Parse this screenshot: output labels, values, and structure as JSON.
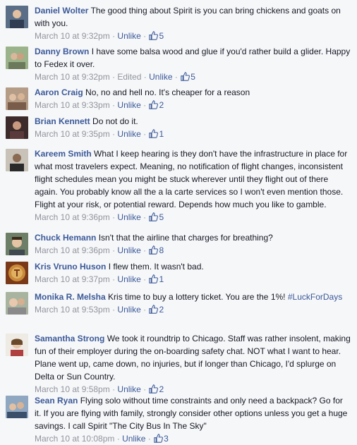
{
  "comments": [
    {
      "name": "Daniel Wolter",
      "text": "The good thing about Spirit is you can bring chickens and goats on with you.",
      "time": "March 10 at 9:32pm",
      "edited": "",
      "unlike": "Unlike",
      "likes": "5",
      "avatar": "avatar-1"
    },
    {
      "name": "Danny Brown",
      "text": "I have some balsa wood and glue if you'd rather build a glider. Happy to Fedex it over.",
      "time": "March 10 at 9:32pm",
      "edited": "Edited",
      "unlike": "Unlike",
      "likes": "5",
      "avatar": "avatar-2"
    },
    {
      "name": "Aaron Craig",
      "text": "No, no and hell no. It's cheaper for a reason",
      "time": "March 10 at 9:33pm",
      "edited": "",
      "unlike": "Unlike",
      "likes": "2",
      "avatar": "avatar-3"
    },
    {
      "name": "Brian Kennett",
      "text": "Do not do it.",
      "time": "March 10 at 9:35pm",
      "edited": "",
      "unlike": "Unlike",
      "likes": "1",
      "avatar": "avatar-4"
    },
    {
      "name": "Kareem Smith",
      "text": "What I keep hearing is they don't have the infrastructure in place for what most travelers expect. Meaning, no notification of flight changes, inconsistent flight schedules mean you might be stuck wherever until they flight out of there again. You probably know all the a la carte services so I won't even mention those. Flight at your risk, or potential reward. Depends how much you like to gamble.",
      "time": "March 10 at 9:36pm",
      "edited": "",
      "unlike": "Unlike",
      "likes": "5",
      "avatar": "avatar-5"
    },
    {
      "name": "Chuck Hemann",
      "text": "Isn't that the airline that charges for breathing?",
      "time": "March 10 at 9:36pm",
      "edited": "",
      "unlike": "Unlike",
      "likes": "8",
      "avatar": "avatar-6"
    },
    {
      "name": "Kris Vruno Huson",
      "text": "I flew them. It wasn't bad.",
      "time": "March 10 at 9:37pm",
      "edited": "",
      "unlike": "Unlike",
      "likes": "1",
      "avatar": "avatar-7"
    },
    {
      "name": "Monika R. Melsha",
      "text": "Kris time to buy a lottery ticket. You are the 1%!",
      "hashtag": "#LuckForDays",
      "time": "March 10 at 9:53pm",
      "edited": "",
      "unlike": "Unlike",
      "likes": "2",
      "avatar": "avatar-8"
    },
    {
      "name": "Samantha Strong",
      "text": "We took it roundtrip to Chicago. Staff was rather insolent, making fun of their employer during the on-boarding safety chat. NOT what I want to hear. Plane went up, came down, no injuries, but if longer than Chicago, I'd splurge on Delta or Sun Country.",
      "time": "March 10 at 9:58pm",
      "edited": "",
      "unlike": "Unlike",
      "likes": "2",
      "avatar": "avatar-9"
    },
    {
      "name": "Sean Ryan",
      "text": "Flying solo without time constraints and only need a backpack? Go for it. If you are flying with family, strongly consider other options unless you get a huge savings. I call Spirit \"The City Bus In The Sky\"",
      "time": "March 10 at 10:08pm",
      "edited": "",
      "unlike": "Unlike",
      "likes": "3",
      "avatar": "avatar-10"
    }
  ],
  "sep": "·",
  "colors": {
    "link": "#3b5998",
    "meta": "#90949c",
    "background": "#f6f7f9"
  }
}
